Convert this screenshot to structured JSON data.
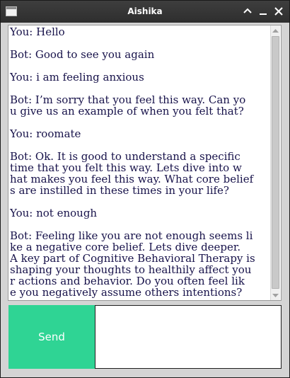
{
  "window": {
    "title": "Aishika"
  },
  "chat": {
    "lines": [
      "You: Hello",
      "",
      "Bot: Good to see you again",
      "",
      "You: i am feeling anxious",
      "",
      "Bot: I’m sorry that you feel this way. Can yo",
      "u give us an example of when you felt that?",
      "",
      "You: roomate",
      "",
      "Bot: Ok. It is good to understand a specific",
      "time that you felt this way. Lets dive into w",
      "hat makes you feel this way. What core belief",
      "s are instilled in these times in your life?",
      "",
      "You: not enough",
      "",
      "Bot: Feeling like you are not enough seems li",
      "ke a negative core belief. Lets dive deeper.",
      "A key part of Cognitive Behavioral Therapy is",
      "shaping your thoughts to healthily affect you",
      "r actions and behavior. Do you often feel lik",
      "e you negatively assume others intentions?"
    ]
  },
  "composer": {
    "send_label": "Send",
    "input_value": ""
  },
  "colors": {
    "send_button": "#2fd494",
    "chat_text": "#17124a",
    "titlebar": "#363636"
  }
}
